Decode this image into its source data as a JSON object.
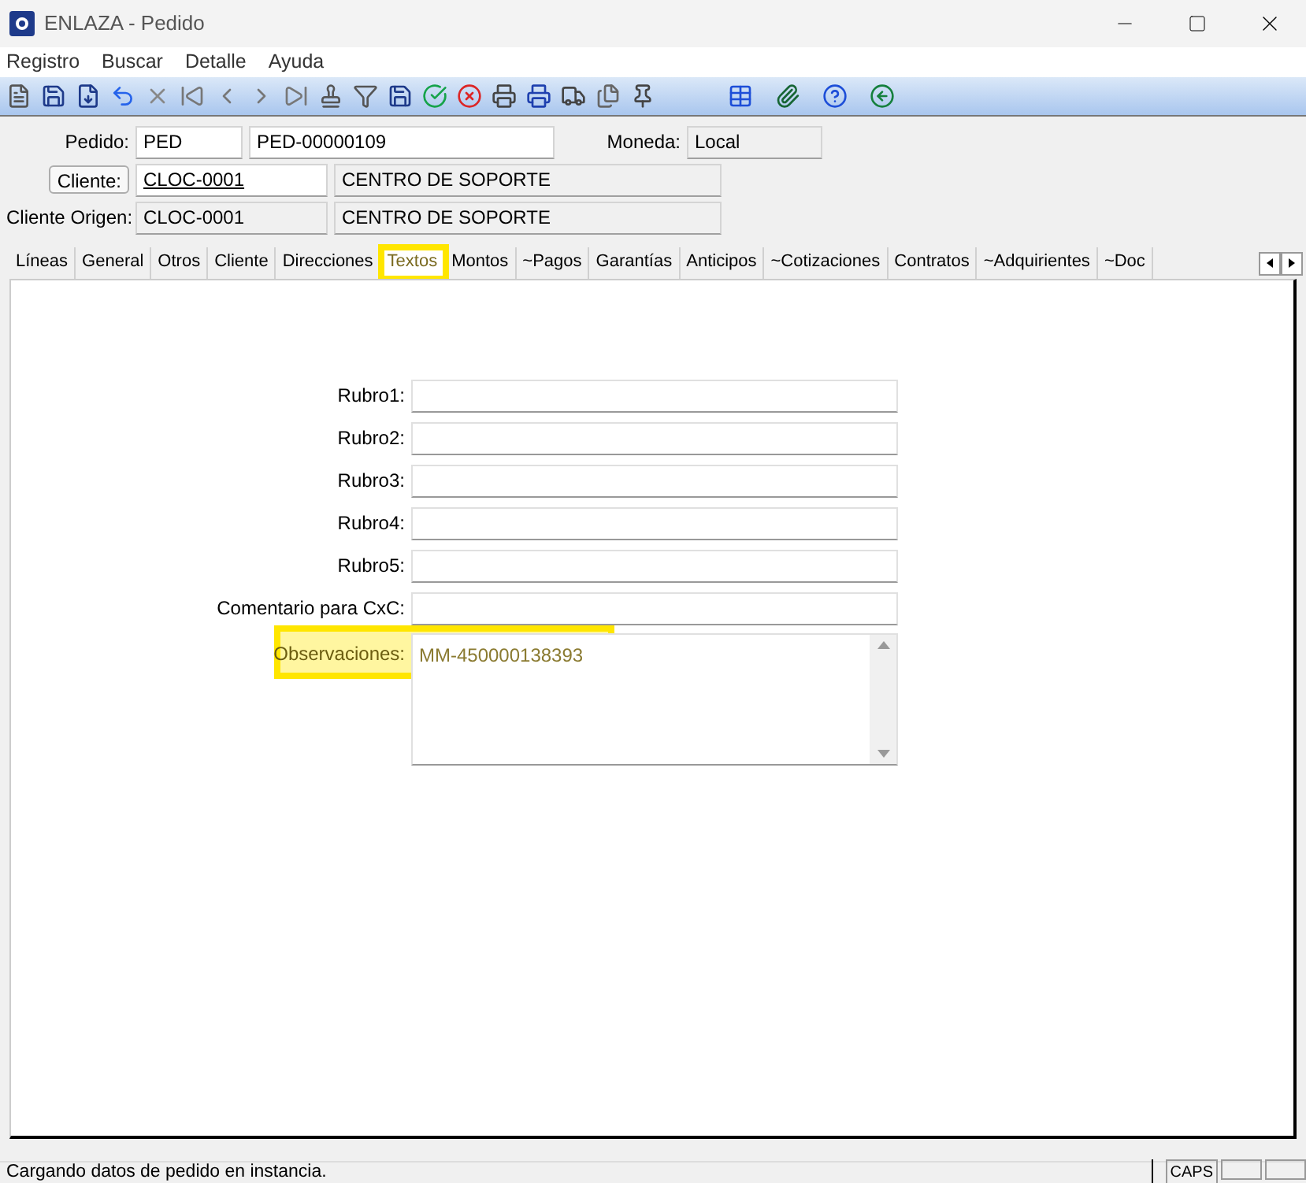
{
  "window": {
    "title": "ENLAZA - Pedido"
  },
  "menu": [
    "Registro",
    "Buscar",
    "Detalle",
    "Ayuda"
  ],
  "header": {
    "pedido_label": "Pedido:",
    "pedido_serie": "PED",
    "pedido_numero": "PED-00000109",
    "moneda_label": "Moneda:",
    "moneda": "Local",
    "cliente_button": "Cliente:",
    "cliente_codigo": "CLOC-0001",
    "cliente_nombre": "CENTRO DE SOPORTE",
    "origen_label": "Cliente Origen:",
    "origen_codigo": "CLOC-0001",
    "origen_nombre": "CENTRO DE SOPORTE"
  },
  "tabs": [
    {
      "label": "Líneas",
      "selected": false,
      "highlighted": false
    },
    {
      "label": "General",
      "selected": false,
      "highlighted": false
    },
    {
      "label": "Otros",
      "selected": false,
      "highlighted": false
    },
    {
      "label": "Cliente",
      "selected": false,
      "highlighted": false
    },
    {
      "label": "Direcciones",
      "selected": false,
      "highlighted": false
    },
    {
      "label": "Textos",
      "selected": true,
      "highlighted": true
    },
    {
      "label": "Montos",
      "selected": false,
      "highlighted": false
    },
    {
      "label": "~Pagos",
      "selected": false,
      "highlighted": false
    },
    {
      "label": "Garantías",
      "selected": false,
      "highlighted": false
    },
    {
      "label": "Anticipos",
      "selected": false,
      "highlighted": false
    },
    {
      "label": "~Cotizaciones",
      "selected": false,
      "highlighted": false
    },
    {
      "label": "Contratos",
      "selected": false,
      "highlighted": false
    },
    {
      "label": "~Adquirientes",
      "selected": false,
      "highlighted": false
    },
    {
      "label": "~Doc",
      "selected": false,
      "highlighted": false
    }
  ],
  "fields": [
    {
      "label": "Rubro1:"
    },
    {
      "label": "Rubro2:"
    },
    {
      "label": "Rubro3:"
    },
    {
      "label": "Rubro4:"
    },
    {
      "label": "Rubro5:"
    },
    {
      "label": "Comentario para CxC:"
    }
  ],
  "observaciones": {
    "label": "Observaciones:",
    "value": "MM-450000138393",
    "highlighted": true
  },
  "status_bar": {
    "message": "Cargando datos de pedido en instancia.",
    "caps": "CAPS"
  }
}
